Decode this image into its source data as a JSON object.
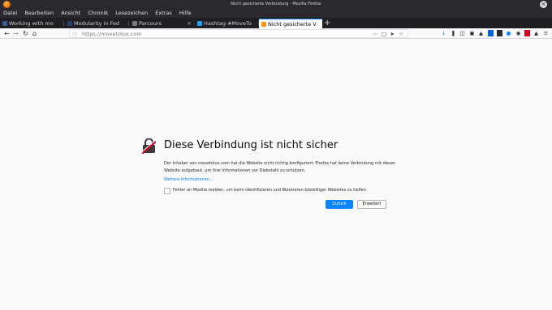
{
  "window": {
    "title": "Nicht gesicherte Verbindung - Mozilla Firefox"
  },
  "menu": [
    "Datei",
    "Bearbeiten",
    "Ansicht",
    "Chronik",
    "Lesezeichen",
    "Extras",
    "Hilfe"
  ],
  "tabs": [
    {
      "label": "Working with mo",
      "favicon_color": "#3b5998",
      "active": false
    },
    {
      "label": "Modularity in Fed",
      "favicon_color": "#294172",
      "active": false
    },
    {
      "label": "Parcours",
      "favicon_color": "#7a7a7a",
      "active": false
    },
    {
      "label": "Hashtag #MoveTo",
      "favicon_color": "#1da1f2",
      "active": false
    },
    {
      "label": "Nicht gesicherte V",
      "favicon_color": "#ff9400",
      "active": true
    }
  ],
  "newtab_label": "+",
  "url": "https://movetolux.com",
  "colors": {
    "accent": "#0a84ff",
    "chrome_dark": "#2a2a2e",
    "page_bg": "#f9f9fa"
  },
  "error": {
    "title": "Diese Verbindung ist nicht sicher",
    "description": "Der Inhaber von movetolux.com hat die Website nicht richtig konfiguriert. Firefox hat keine Verbindung mit dieser Website aufgebaut, um Ihre Informationen vor Diebstahl zu schützen.",
    "more_info": "Weitere Informationen…",
    "report_checkbox": "Fehler an Mozilla melden, um beim Identifizieren und Blockieren böswilliger Websites zu helfen",
    "back_button": "Zurück",
    "advanced_button": "Erweitert"
  }
}
